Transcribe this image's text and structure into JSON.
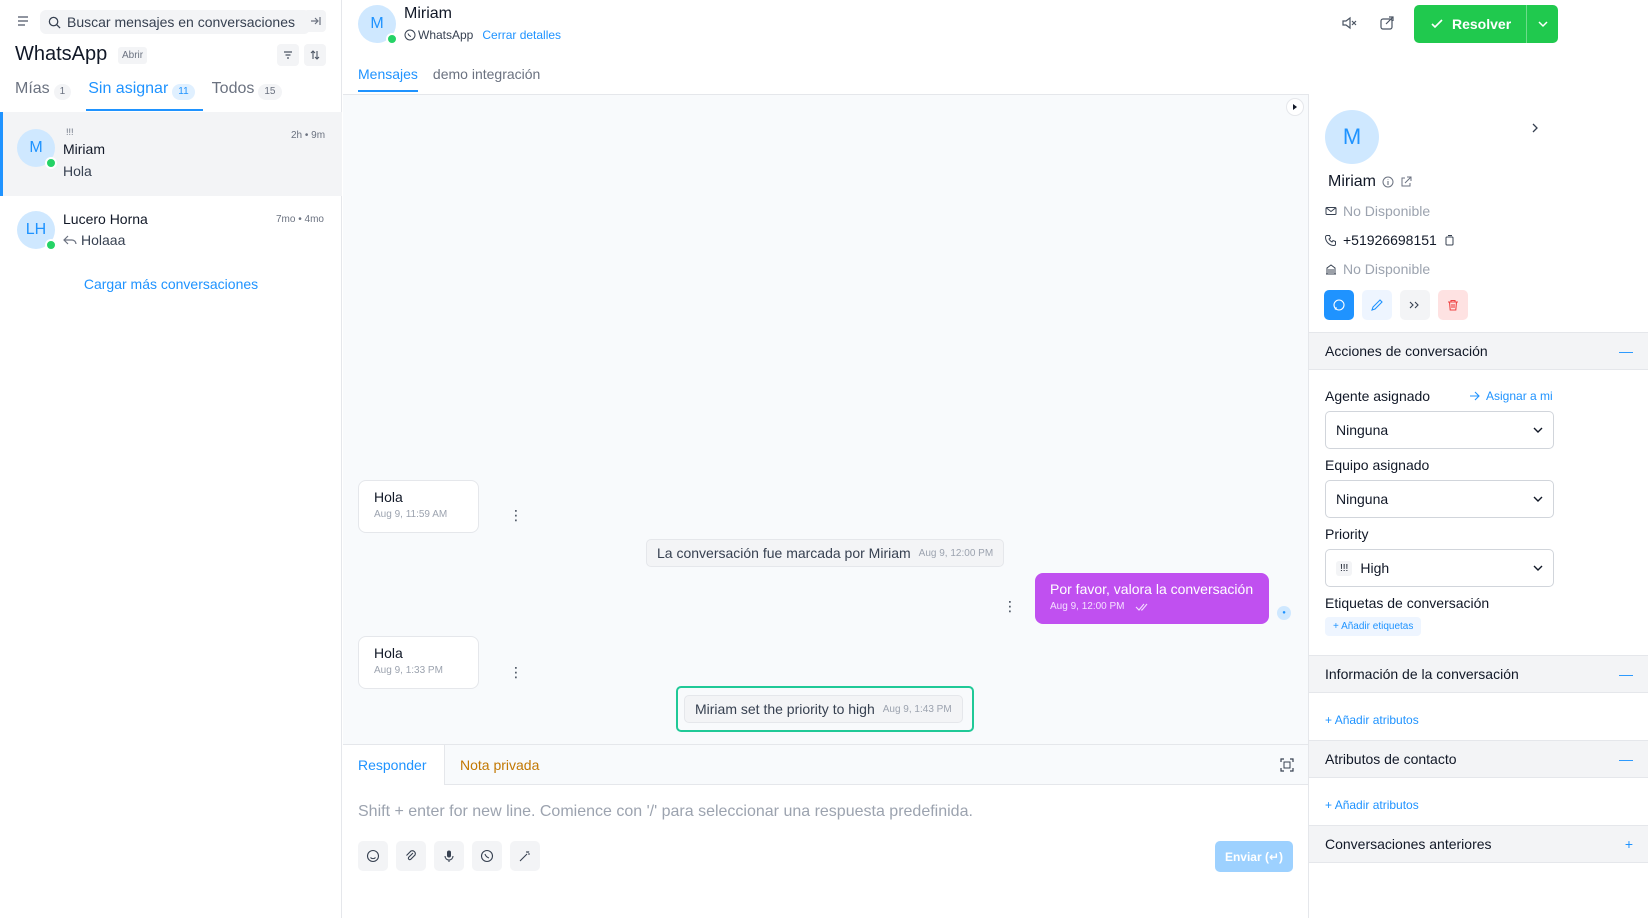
{
  "sidebar": {
    "search_placeholder": "Buscar mensajes en conversaciones",
    "inbox_title": "WhatsApp",
    "status": "Abrir",
    "tabs": [
      {
        "label": "Mías",
        "count": "1"
      },
      {
        "label": "Sin asignar",
        "count": "11"
      },
      {
        "label": "Todos",
        "count": "15"
      }
    ],
    "conversations": [
      {
        "initials": "M",
        "priority": "!!!",
        "name": "Miriam",
        "message": "Hola",
        "time": "2h • 9m"
      },
      {
        "initials": "LH",
        "name": "Lucero Horna",
        "message": "Holaaa",
        "time": "7mo • 4mo"
      }
    ],
    "load_more": "Cargar más conversaciones"
  },
  "chat": {
    "contact_initial": "M",
    "contact_name": "Miriam",
    "channel": "WhatsApp",
    "close_details": "Cerrar detalles",
    "resolve_label": "Resolver",
    "tabs": [
      "Mensajes",
      "demo integración"
    ],
    "messages": [
      {
        "text": "Hola",
        "time": "Aug 9, 11:59 AM"
      },
      {
        "text": "La conversación fue marcada por Miriam",
        "time": "Aug 9, 12:00 PM"
      },
      {
        "text": "Por favor, valora la conversación",
        "time": "Aug 9, 12:00 PM"
      },
      {
        "text": "Hola",
        "time": "Aug 9, 1:33 PM"
      },
      {
        "text": "Miriam set the priority to high",
        "time": "Aug 9, 1:43 PM"
      }
    ],
    "reply_tab": "Responder",
    "private_tab": "Nota privada",
    "placeholder": "Shift + enter for new line. Comience con '/' para seleccionar una respuesta predefinida.",
    "send_label": "Enviar (↵)"
  },
  "contact": {
    "initial": "M",
    "name": "Miriam",
    "email": "No Disponible",
    "phone": "+51926698151",
    "company": "No Disponible",
    "actions_title": "Acciones de conversación",
    "agent_label": "Agente asignado",
    "assign_me": "Asignar a mi",
    "agent_value": "Ninguna",
    "team_label": "Equipo asignado",
    "team_value": "Ninguna",
    "priority_label": "Priority",
    "priority_icon": "!!!",
    "priority_value": "High",
    "labels_title": "Etiquetas de conversación",
    "add_labels": "Añadir etiquetas",
    "conv_info_title": "Información de la conversación",
    "add_attributes": "Añadir atributos",
    "contact_attrs_title": "Atributos de contacto",
    "prev_conversations": "Conversaciones anteriores"
  },
  "colors": {
    "accent": "#1f93ff",
    "resolve": "#20c94e",
    "outgoing": "#c050f0",
    "highlight": "#20c997"
  }
}
